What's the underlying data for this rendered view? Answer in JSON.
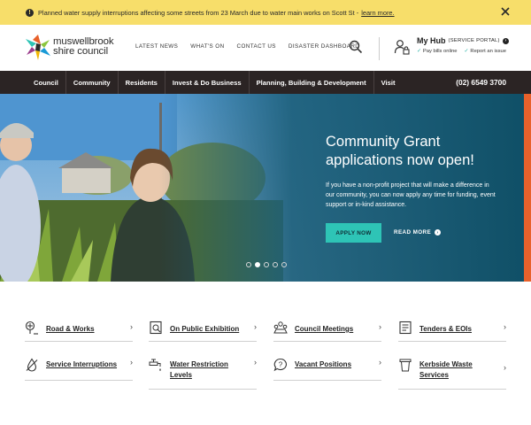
{
  "alert": {
    "text": "Planned water supply interruptions affecting some streets from 23 March due to water main works on Scott St -",
    "link": "learn more."
  },
  "header": {
    "logo_line1": "muswellbrook",
    "logo_line2": "shire council",
    "topnav": [
      "LATEST NEWS",
      "WHAT'S ON",
      "CONTACT US",
      "DISASTER DASHBOARD"
    ],
    "hub_title": "My Hub",
    "hub_sub": "(SERVICE PORTAL)",
    "hub_links": [
      "Pay bills online",
      "Report an issue"
    ]
  },
  "mainnav": {
    "items": [
      "Council",
      "Community",
      "Residents",
      "Invest & Do Business",
      "Planning, Building & Development",
      "Visit"
    ],
    "phone": "(02) 6549 3700"
  },
  "hero": {
    "title": "Community Grant applications now open!",
    "body": "If you have a non-profit project that will make a difference in our community, you can now apply any time for funding, event support or in-kind assistance.",
    "button": "APPLY NOW",
    "more": "READ MORE",
    "slide_count": 5,
    "active_slide": 2
  },
  "quicklinks": [
    {
      "label": "Road & Works",
      "icon": "road-icon"
    },
    {
      "label": "On Public Exhibition",
      "icon": "exhibition-icon"
    },
    {
      "label": "Council Meetings",
      "icon": "meeting-icon"
    },
    {
      "label": "Tenders & EOIs",
      "icon": "tender-icon"
    },
    {
      "label": "Service Interruptions",
      "icon": "no-water-icon"
    },
    {
      "label": "Water Restriction Levels",
      "icon": "tap-icon"
    },
    {
      "label": "Vacant Positions",
      "icon": "speech-question-icon"
    },
    {
      "label": "Kerbside Waste Services",
      "icon": "bin-icon"
    }
  ],
  "colors": {
    "alert_bg": "#f7de6a",
    "nav_bg": "#2b2424",
    "accent": "#2ec4b6",
    "hero_teal": "#1d5f7a"
  }
}
